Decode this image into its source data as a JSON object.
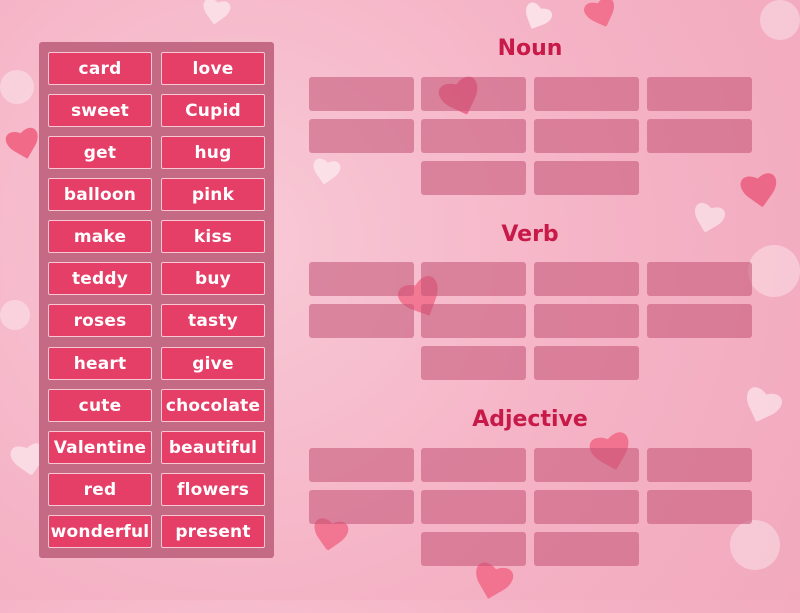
{
  "word_bank": {
    "words": [
      [
        "card",
        "love"
      ],
      [
        "sweet",
        "Cupid"
      ],
      [
        "get",
        "hug"
      ],
      [
        "balloon",
        "pink"
      ],
      [
        "make",
        "kiss"
      ],
      [
        "teddy",
        "buy"
      ],
      [
        "roses",
        "tasty"
      ],
      [
        "heart",
        "give"
      ],
      [
        "cute",
        "chocolate"
      ],
      [
        "Valentine",
        "beautiful"
      ],
      [
        "red",
        "flowers"
      ],
      [
        "wonderful",
        "present"
      ]
    ]
  },
  "categories": [
    {
      "title": "Noun",
      "slots": 10
    },
    {
      "title": "Verb",
      "slots": 10
    },
    {
      "title": "Adjective",
      "slots": 10
    }
  ],
  "colors": {
    "tile": "#e53e67",
    "bank": "#c46a85",
    "title": "#c81a48",
    "slot": "#c35274"
  }
}
